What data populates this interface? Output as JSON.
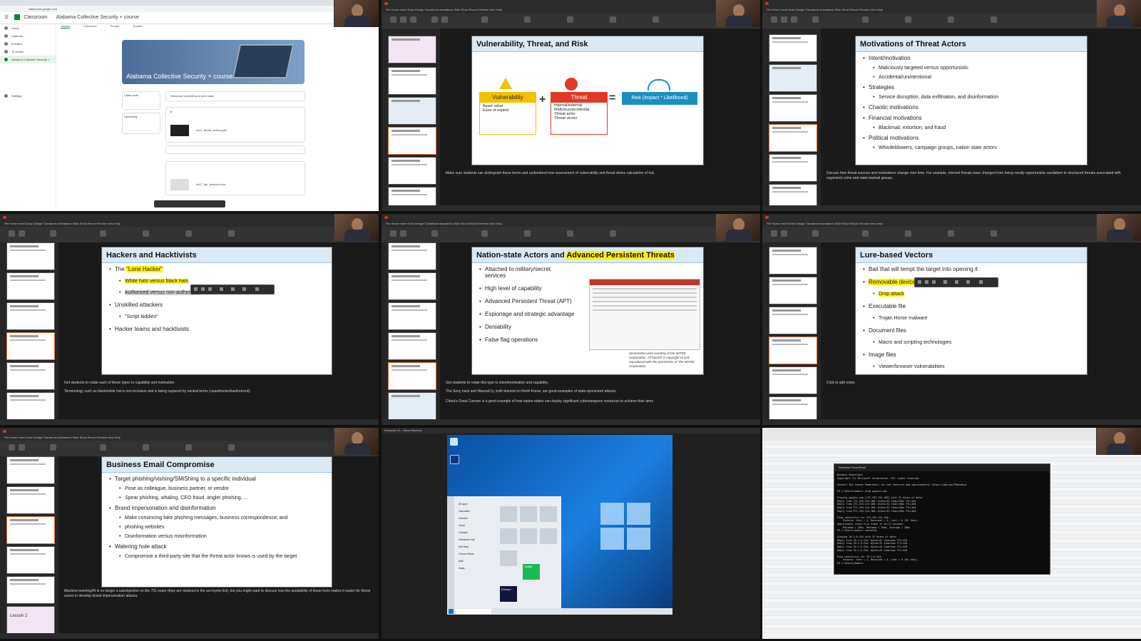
{
  "classroom": {
    "address": "classroom.google.com",
    "app_name": "Classroom",
    "course_header": "Alabama Collective Security + course",
    "tabs": [
      "Stream",
      "Classwork",
      "People",
      "Grades"
    ],
    "sidebar": [
      "Home",
      "Calendar",
      "Enrolled",
      "To review",
      "Alabama Collective Security +",
      "Settings"
    ],
    "banner_title": "Alabama Collective Security + course",
    "class_code_label": "Class code",
    "upcoming_label": "Upcoming",
    "announce_placeholder": "Announce something to your class",
    "post_attachment": "ch07_threat_actors.pptx",
    "post_attachment_2": "ch07_lab_session.docx"
  },
  "vtr": {
    "title": "Vulnerability, Threat, and Risk",
    "vuln_label": "Vulnerability",
    "vuln_items": [
      "Asset value",
      "Ease of exploit"
    ],
    "threat_label": "Threat",
    "threat_items": [
      "Internal/external",
      "Malicious/accidental",
      "Threat actor",
      "Threat vector"
    ],
    "plus": "+",
    "equals": "=",
    "risk_label": "Risk (Impact * Likelihood)",
    "note": "Make sure students can distinguish these terms and understand how assessment of vulnerability and threat drives calculation of risk."
  },
  "motivations": {
    "title": "Motivations of Threat Actors",
    "bullets": [
      {
        "text": "Intent/motivation",
        "sub": false
      },
      {
        "text": "Maliciously targeted versus opportunistic",
        "sub": true
      },
      {
        "text": "Accidental/unintentional",
        "sub": true
      },
      {
        "text": "Strategies",
        "sub": false
      },
      {
        "text": "Service disruption, data exfiltration, and disinformation",
        "sub": true
      },
      {
        "text": "Chaotic motivations",
        "sub": false
      },
      {
        "text": "Financial motivations",
        "sub": false
      },
      {
        "text": "Blackmail, extortion, and fraud",
        "sub": true
      },
      {
        "text": "Political motivations",
        "sub": false
      },
      {
        "text": "Whistleblowers, campaign groups, nation state actors",
        "sub": true
      }
    ],
    "note": "Discuss how threat sources and motivations change over time. For example, internet threats have changed from being mostly opportunistic vandalism to structured threats associated with organized crime and state-backed groups."
  },
  "hackers": {
    "title": "Hackers and Hacktivists",
    "b1_prefix": "The ",
    "b1_highlight": "\"Lone Hacker\"",
    "b1_sub1": "White hats versus black hats",
    "b1_sub2": "Authorized versus non-authorized",
    "b2": "Unskilled attackers",
    "b2_sub": "\"Script kiddies\"",
    "b3": "Hacker teams and hacktivists",
    "note1": "Get students to relate each of these types to capability and motivation.",
    "note2": "Terminology such as black/white hat is non-inclusive and is being replaced by neutral terms (unauthorized/authorized)."
  },
  "nation": {
    "title_prefix": "Nation-state Actors and ",
    "title_highlight": "Advanced Persistent Threats",
    "bullets": [
      "Attached to military/secret services",
      "High level of capability",
      "Advanced Persistent Threat (APT)",
      "Espionage and strategic advantage",
      "Deniability",
      "False flag operations"
    ],
    "caption": "Screenshot used courtesy of the MITRE Corporation. ATT&CK® is copyright of and reproduced with the permission of The MITRE Corporation.",
    "note1": "Get students to relate this type to intent/motivation and capability.",
    "note2": "The Sony hack and WannaCry, both blamed on North Korea, are good examples of state-sponsored attacks.",
    "note3": "China's Great Cannon is a good example of how nation-states can deploy significant cyberweapons resources to achieve their aims."
  },
  "lure": {
    "title": "Lure-based Vectors",
    "b1": "Bait that will tempt the target into opening it",
    "b2": "Removable device",
    "b2_sub": "Drop attack",
    "b3": "Executable file",
    "b3_sub": "Trojan Horse malware",
    "b4": "Document files",
    "b4_sub": "Macro and scripting technologies",
    "b5": "Image files",
    "b5_sub": "Viewer/browser vulnerabilities",
    "note": "Click to add notes"
  },
  "bec": {
    "title": "Business Email Compromise",
    "bullets": [
      {
        "text": "Target phishing/vishing/SMiShing to a specific individual",
        "sub": false
      },
      {
        "text": "Pose as colleague, business partner, or vendor",
        "sub": true
      },
      {
        "text": "Spear phishing, whaling, CEO fraud, angler phishing, ...",
        "sub": true
      },
      {
        "text": "Brand impersonation and disinformation",
        "sub": false
      },
      {
        "text": "Make convincing fake phishing messages, business correspondence, and",
        "sub": true
      },
      {
        "text": "phishing websites",
        "sub": true
      },
      {
        "text": "Disinformation versus misinformation",
        "sub": true
      },
      {
        "text": "Watering hole attack",
        "sub": false
      },
      {
        "text": "Compromise a third-party site that the threat actor knows is used by the target",
        "sub": true
      }
    ],
    "note": "Machine learning/AI is no longer a subobjective on the 701 exam (they are retained in the acronyms list), but you might want to discuss how the availability of these tools makes it easier for threat actors to develop brand impersonation attacks.",
    "thumb_lesson": "Lesson 2"
  },
  "windows": {
    "vm_title": "Windows 10 - Virtual Machine",
    "start_items": [
      "All apps",
      "Calculator",
      "Camera",
      "Clock",
      "Cortana",
      "Feedback Hub",
      "Get Help",
      "Groove Music",
      "Mail",
      "Maps"
    ],
    "tile_labels": [
      "Spotify",
      "Disney+"
    ]
  },
  "terminal": {
    "title": "Windows PowerShell",
    "lines": [
      "Windows PowerShell",
      "Copyright (C) Microsoft Corporation. All rights reserved.",
      "",
      "Install the latest PowerShell for new features and improvements! https://aka.ms/PSWindows",
      "",
      "PS C:\\Users\\Admin> ping google.com",
      "",
      "Pinging google.com [172.253.124.100] with 32 bytes of data:",
      "Reply from 172.253.124.100: bytes=32 time=19ms TTL=104",
      "Reply from 172.253.124.100: bytes=32 time=18ms TTL=104",
      "Reply from 172.253.124.100: bytes=32 time=18ms TTL=104",
      "Reply from 172.253.124.100: bytes=32 time=19ms TTL=104",
      "",
      "Ping statistics for 172.253.124.100:",
      "    Packets: Sent = 4, Received = 4, Lost = 0 (0% loss),",
      "Approximate round trip times in milli-seconds:",
      "    Minimum = 18ms, Maximum = 19ms, Average = 18ms",
      "PS C:\\Users\\Admin> ipconfig",
      "",
      "Pinging 10.1.0.254 with 32 bytes of data:",
      "Reply from 10.1.0.254: bytes=32 time<1ms TTL=128",
      "Reply from 10.1.0.254: bytes=32 time<1ms TTL=128",
      "Reply from 10.1.0.254: bytes=32 time<1ms TTL=128",
      "Reply from 10.1.0.254: bytes=32 time<1ms TTL=128",
      "",
      "Ping statistics for 10.1.0.254:",
      "    Packets: Sent = 4, Received = 4, Lost = 0 (0% loss),",
      "PS C:\\Users\\Admin>"
    ]
  },
  "pp_menu": "File  Home  Insert  Draw  Design  Transitions  Animations  Slide Show  Record  Review  View  Help",
  "colors": {
    "accent": "#e36c3a",
    "vuln": "#f4c000",
    "threat": "#e03a26",
    "risk": "#1b8fbf"
  }
}
